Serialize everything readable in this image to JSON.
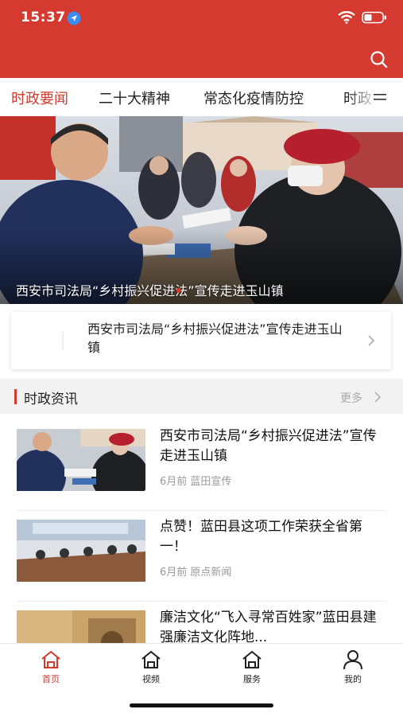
{
  "status_bar": {
    "time": "15:37"
  },
  "colors": {
    "brand": "#d43a2f",
    "muted": "#999999",
    "section_bg": "#f2f2f2"
  },
  "tabs": [
    {
      "label": "时政要闻",
      "active": true
    },
    {
      "label": "二十大精神",
      "active": false
    },
    {
      "label": "常态化疫情防控",
      "active": false
    },
    {
      "label": "时政",
      "active": false
    }
  ],
  "banner": {
    "caption": "西安市司法局“乡村振兴促进法”宣传走进玉山镇"
  },
  "headline": {
    "text": "西安市司法局“乡村振兴促进法”宣传走进玉山镇"
  },
  "section": {
    "title": "时政资讯",
    "more": "更多"
  },
  "news": [
    {
      "title": "西安市司法局“乡村振兴促进法”宣传走进玉山镇",
      "meta": "6月前 蓝田宣传"
    },
    {
      "title": "点赞！蓝田县这项工作荣获全省第一！",
      "meta": "6月前 原点新闻"
    },
    {
      "title": "廉洁文化“飞入寻常百姓家”蓝田县建强廉洁文化阵地...",
      "meta": ""
    }
  ],
  "bottom_nav": [
    {
      "label": "首页",
      "icon": "home-icon",
      "active": true
    },
    {
      "label": "视频",
      "icon": "home-icon",
      "active": false
    },
    {
      "label": "服务",
      "icon": "home-icon",
      "active": false
    },
    {
      "label": "我的",
      "icon": "user-icon",
      "active": false
    }
  ]
}
